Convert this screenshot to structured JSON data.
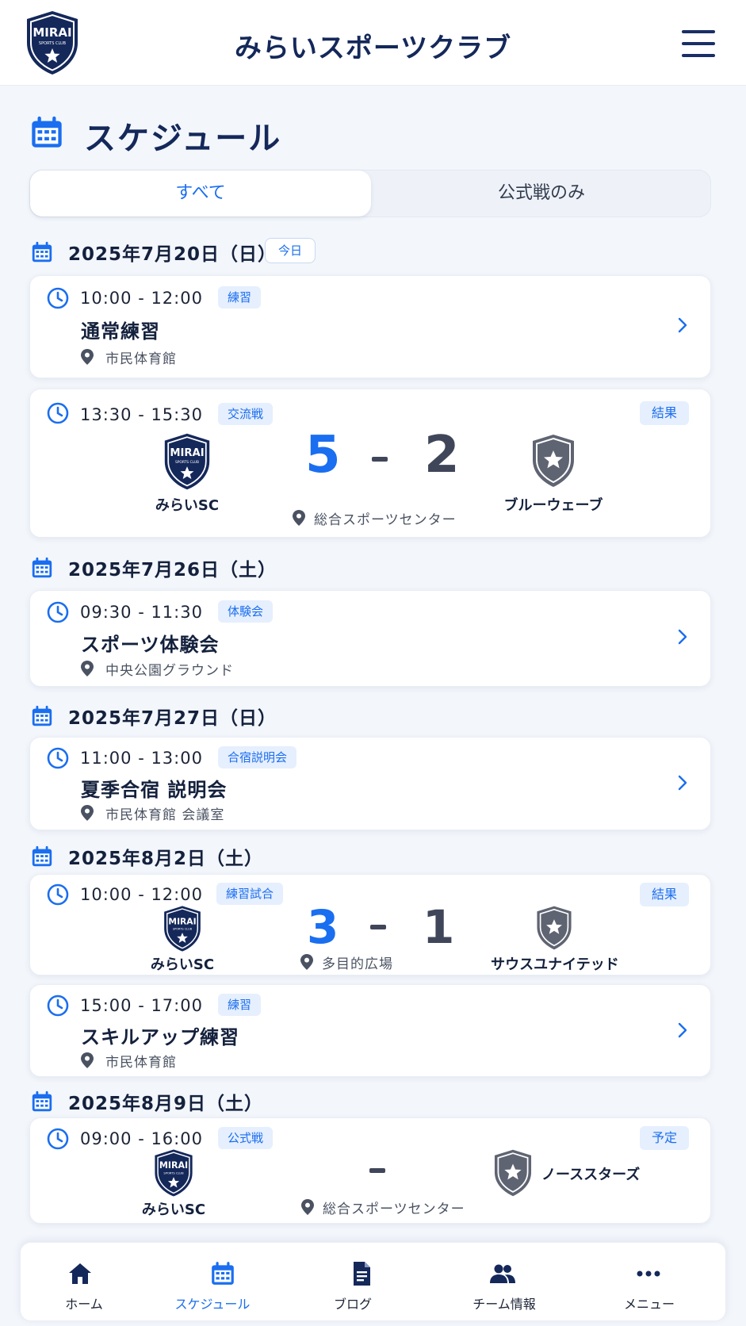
{
  "header": {
    "logo_text": "MIRAI",
    "logo_sub": "SPORTS CLUB",
    "title": "みらいスポーツクラブ"
  },
  "page": {
    "title": "スケジュール"
  },
  "filter_tabs": [
    {
      "label": "すべて",
      "active": true
    },
    {
      "label": "公式戦のみ",
      "active": false
    }
  ],
  "today_badge": "今日",
  "dates": [
    {
      "label": "2025年7月20日（日）"
    },
    {
      "label": "2025年7月26日（土）"
    },
    {
      "label": "2025年7月27日（日）"
    },
    {
      "label": "2025年8月2日（土）"
    },
    {
      "label": "2025年8月9日（土）"
    }
  ],
  "events": [
    {
      "time": "10:00 - 12:00",
      "tag": "練習",
      "title": "通常練習",
      "location": "市民体育館"
    },
    {
      "time": "13:30 - 15:30",
      "tag": "交流戦",
      "status": "結果",
      "home_team": "みらいSC",
      "away_team": "ブルーウェーブ",
      "home_score": "5",
      "away_score": "2",
      "location": "総合スポーツセンター"
    },
    {
      "time": "09:30 - 11:30",
      "tag": "体験会",
      "title": "スポーツ体験会",
      "location": "中央公園グラウンド"
    },
    {
      "time": "11:00 - 13:00",
      "tag": "合宿説明会",
      "title": "夏季合宿 説明会",
      "location": "市民体育館 会議室"
    },
    {
      "time": "10:00 - 12:00",
      "tag": "練習試合",
      "status": "結果",
      "home_team": "みらいSC",
      "away_team": "サウスユナイテッド",
      "home_score": "3",
      "away_score": "1",
      "location": "多目的広場"
    },
    {
      "time": "15:00 - 17:00",
      "tag": "練習",
      "title": "スキルアップ練習",
      "location": "市民体育館"
    },
    {
      "time": "09:00 - 16:00",
      "tag": "公式戦",
      "status": "予定",
      "home_team": "みらいSC",
      "away_team": "ノーススターズ",
      "location": "総合スポーツセンター"
    }
  ],
  "bottom_nav": [
    {
      "label": "ホーム",
      "icon": "home-icon"
    },
    {
      "label": "スケジュール",
      "icon": "calendar-icon",
      "active": true
    },
    {
      "label": "ブログ",
      "icon": "document-icon"
    },
    {
      "label": "チーム情報",
      "icon": "users-icon"
    },
    {
      "label": "メニュー",
      "icon": "more-icon"
    }
  ],
  "colors": {
    "accent": "#1a6ef0",
    "navy": "#14285a",
    "away_crest": "#5f6472",
    "tag_bg": "#e6effd"
  }
}
